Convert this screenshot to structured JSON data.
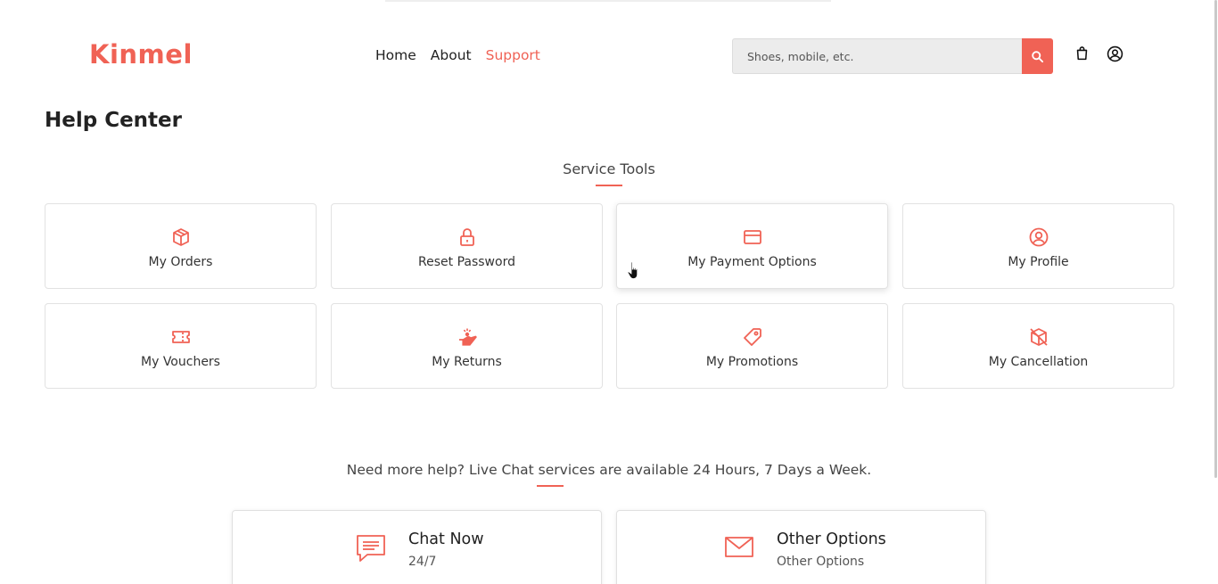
{
  "header": {
    "logo": "Kinmel",
    "nav": [
      {
        "label": "Home",
        "active": false
      },
      {
        "label": "About",
        "active": false
      },
      {
        "label": "Support",
        "active": true
      }
    ],
    "search": {
      "placeholder": "Shoes, mobile, etc.",
      "value": ""
    },
    "icons": {
      "search": "search-icon",
      "cart": "shopping-bag-icon",
      "account": "user-circle-icon"
    }
  },
  "page": {
    "title": "Help Center"
  },
  "service_tools": {
    "title": "Service Tools",
    "items": [
      {
        "label": "My Orders",
        "icon": "box-icon"
      },
      {
        "label": "Reset Password",
        "icon": "lock-icon"
      },
      {
        "label": "My Payment Options",
        "icon": "credit-card-icon"
      },
      {
        "label": "My Profile",
        "icon": "user-circle-icon"
      },
      {
        "label": "My Vouchers",
        "icon": "ticket-icon"
      },
      {
        "label": "My Returns",
        "icon": "hand-coin-icon"
      },
      {
        "label": "My Promotions",
        "icon": "tag-icon"
      },
      {
        "label": "My Cancellation",
        "icon": "box-cancel-icon"
      }
    ]
  },
  "help": {
    "title": "Need more help? Live Chat services are available 24 Hours, 7 Days a Week.",
    "options": [
      {
        "title": "Chat Now",
        "subtitle": "24/7",
        "icon": "chat-message-icon"
      },
      {
        "title": "Other Options",
        "subtitle": "Other Options",
        "icon": "envelope-icon"
      }
    ]
  },
  "colors": {
    "accent": "#f06255",
    "border": "#e2e2e2",
    "text": "#222222"
  }
}
